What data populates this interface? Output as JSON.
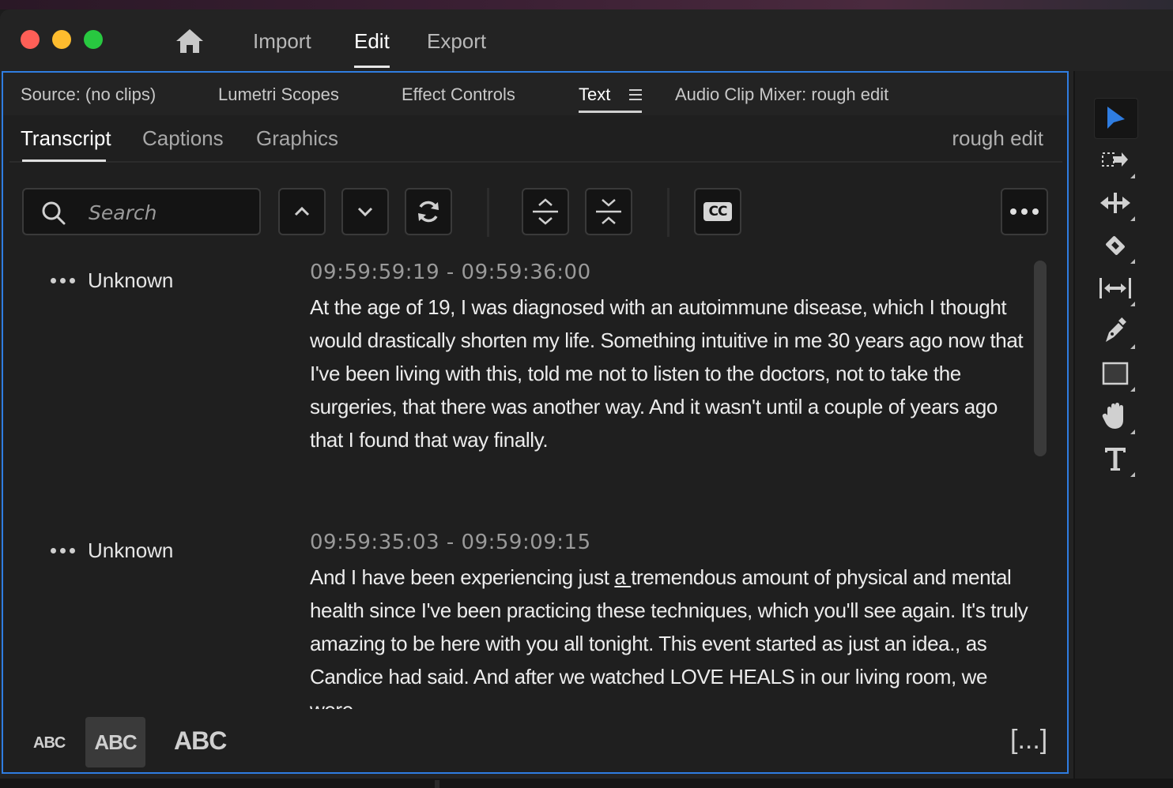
{
  "workspace": {
    "home_icon": "home-icon",
    "tabs": [
      {
        "label": "Import"
      },
      {
        "label": "Edit"
      },
      {
        "label": "Export"
      }
    ],
    "active_tab": "Edit"
  },
  "panel": {
    "tabs": [
      {
        "label": "Source: (no clips)"
      },
      {
        "label": "Lumetri Scopes"
      },
      {
        "label": "Effect Controls"
      },
      {
        "label": "Text"
      },
      {
        "label": "Audio Clip Mixer: rough edit"
      }
    ],
    "active_tab": "Text",
    "subtabs": [
      {
        "label": "Transcript"
      },
      {
        "label": "Captions"
      },
      {
        "label": "Graphics"
      }
    ],
    "active_subtab": "Transcript",
    "sequence_name": "rough edit"
  },
  "toolbar": {
    "search_placeholder": "Search",
    "search_value": "",
    "cc_label": "CC",
    "buttons": [
      "previous-result",
      "next-result",
      "refresh",
      "expand-segments",
      "collapse-segments",
      "create-captions",
      "more-options"
    ]
  },
  "transcript": {
    "segments": [
      {
        "speaker": "Unknown",
        "timecode": "09:59:59:19 - 09:59:36:00",
        "text": "At the age of 19, I was diagnosed with an autoimmune disease, which I thought would drastically shorten my life. Something intuitive in me 30 years ago now that I've been living with this, told me not to listen to the doctors, not to take the surgeries, that there was another way. And it wasn't until a couple of years ago that I found that way finally."
      },
      {
        "speaker": "Unknown",
        "timecode": "09:59:35:03 - 09:59:09:15",
        "text_before": "And I have been experiencing just ",
        "text_underlined": "a ",
        "text_after": "tremendous amount of physical and mental health since I've been practicing these techniques, which you'll see again. It's truly amazing to be here with you all tonight. This event started as just an idea., as Candice had said. And after we watched LOVE HEALS in our living room, we were"
      }
    ]
  },
  "bottom": {
    "abc_small": "ABC",
    "abc_mid": "ABC",
    "abc_large": "ABC",
    "bracket": "[...]"
  },
  "tools": {
    "items": [
      "selection-tool-icon",
      "track-select-tool-icon",
      "ripple-edit-tool-icon",
      "razor-tool-icon",
      "slip-tool-icon",
      "pen-tool-icon",
      "rectangle-tool-icon",
      "hand-tool-icon",
      "type-tool-icon"
    ],
    "active": "selection-tool-icon",
    "accent": "#2f7de1"
  },
  "colors": {
    "traffic_red": "#fe5f57",
    "traffic_yellow": "#febc2e",
    "traffic_green": "#28c840",
    "panel_border": "#2f7de1"
  }
}
